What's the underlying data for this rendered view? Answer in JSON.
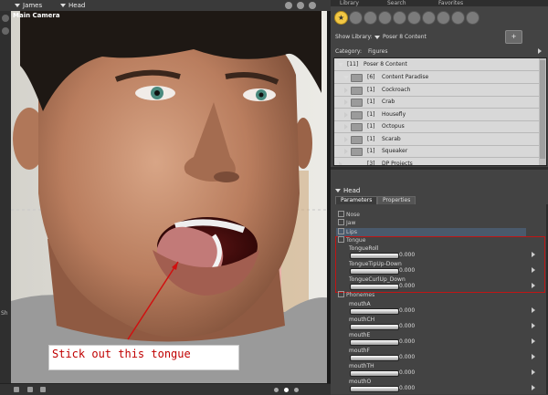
{
  "viewport": {
    "figure_menu": "James",
    "actor_menu": "Head",
    "camera_label": "Main Camera",
    "side_label": "Sh"
  },
  "annotation": {
    "text": "Stick out this tongue",
    "color": "#c00000"
  },
  "library": {
    "tabs": [
      "Library",
      "Search",
      "Favorites"
    ],
    "icons": [
      "figures-icon",
      "hair-icon",
      "pose-icon",
      "expression-icon",
      "hand-icon",
      "props-icon",
      "light-icon",
      "camera-icon",
      "materials-icon",
      "scene-icon"
    ],
    "active_color": "#f2c744",
    "show_library_label": "Show Library:",
    "show_library_value": "Poser 8 Content",
    "category_label": "Category:",
    "category_value": "Figures",
    "tree": [
      {
        "count": "[11]",
        "label": "Poser 8 Content",
        "indent": 0
      },
      {
        "count": "[6]",
        "label": "Content Paradise",
        "indent": 1
      },
      {
        "count": "[1]",
        "label": "Cockroach",
        "indent": 2
      },
      {
        "count": "[1]",
        "label": "Crab",
        "indent": 2
      },
      {
        "count": "[1]",
        "label": "Housefly",
        "indent": 2
      },
      {
        "count": "[1]",
        "label": "Octopus",
        "indent": 2
      },
      {
        "count": "[1]",
        "label": "Scarab",
        "indent": 2
      },
      {
        "count": "[1]",
        "label": "Squeaker",
        "indent": 2
      },
      {
        "count": "[3]",
        "label": "DP Projects",
        "indent": 1
      }
    ]
  },
  "params": {
    "title": "Head",
    "tabs": [
      "Parameters",
      "Properties"
    ],
    "groups": [
      "Nose",
      "Jaw",
      "Lips",
      "Tongue",
      "Phonemes"
    ],
    "tongue_dials": [
      {
        "name": "TongueRoll",
        "value": "0.000"
      },
      {
        "name": "TongueTipUp-Down",
        "value": "0.000"
      },
      {
        "name": "TongueCurlUp_Down",
        "value": "0.000"
      }
    ],
    "phoneme_dials": [
      {
        "name": "mouthA",
        "value": "0.000"
      },
      {
        "name": "mouthCH",
        "value": "0.000"
      },
      {
        "name": "mouthE",
        "value": "0.000"
      },
      {
        "name": "mouthF",
        "value": "0.000"
      },
      {
        "name": "mouthTH",
        "value": "0.000"
      },
      {
        "name": "mouthO",
        "value": "0.000"
      }
    ],
    "highlight_color": "#c01515"
  }
}
